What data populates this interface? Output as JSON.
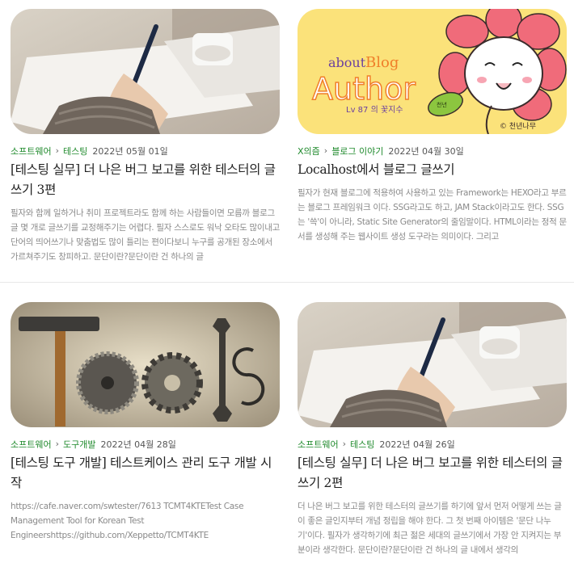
{
  "posts": [
    {
      "category": "소프트웨어",
      "subcategory": "테스팅",
      "date": "2022년 05월 01일",
      "title": "[테스팅 실무] 더 나은 버그 보고를 위한 테스터의 글쓰기 3편",
      "excerpt": "필자와 함께 일하거나 취미 프로젝트라도 함께 하는 사람들이면 모름까 블로그 글 몇 개로 글쓰기를 교정해주기는 어렵다. 필자 스스로도 워낙 오타도 많이내고 단어의 띄어쓰기나 맞춤법도 많이 틀리는 편이다보니 누구를 공개된 장소에서 가르쳐주기도 창피하고. 문단이란?문단이란 건 하나의 글"
    },
    {
      "category": "X의즘",
      "subcategory": "블로그 이야기",
      "date": "2022년 04월 30일",
      "title": "Localhost에서 블로그 글쓰기",
      "excerpt": "필자가 현재 블로그에 적용하여 사용하고 있는 Framework는 HEXO라고 부르는 블로그 프레임워크 이다. SSG라고도 하고, JAM Stack이라고도 한다. SSG는 '쓱'이 아니라, Static Site Generator의 줄임말이다. HTML이라는 정적 문서를 생성해 주는 웹사이트 생성 도구라는 의미이다. 그리고",
      "thumb_text": {
        "about": "about",
        "blog": "Blog",
        "author": "Author",
        "level": "Lv 87 의 꽃지수",
        "signature": "© 천년나무",
        "leaf": "천년"
      }
    },
    {
      "category": "소프트웨어",
      "subcategory": "도구개발",
      "date": "2022년 04월 28일",
      "title": "[테스팅 도구 개발] 테스트케이스 관리 도구 개발 시작",
      "excerpt": "https://cafe.naver.com/swtester/7613 TCMT4KTETest Case Management Tool for Korean Test Engineershttps://github.com/Xeppetto/TCMT4KTE"
    },
    {
      "category": "소프트웨어",
      "subcategory": "테스팅",
      "date": "2022년 04월 26일",
      "title": "[테스팅 실무] 더 나은 버그 보고를 위한 테스터의 글쓰기 2편",
      "excerpt": "더 나은 버그 보고를 위한 테스터의 글쓰기를 하기에 앞서 먼저 어떻게 쓰는 글이 좋은 글인지부터 개념 정립을 해야 한다. 그 첫 번째 아이템은 '문단 나누기'이다. 필자가 생각하기에 최근 젊은 세대의 글쓰기에서 가장 안 지켜지는 부분이라 생각한다. 문단이란?문단이란 건 하나의 글 내에서 생각의"
    }
  ],
  "separator": "›"
}
